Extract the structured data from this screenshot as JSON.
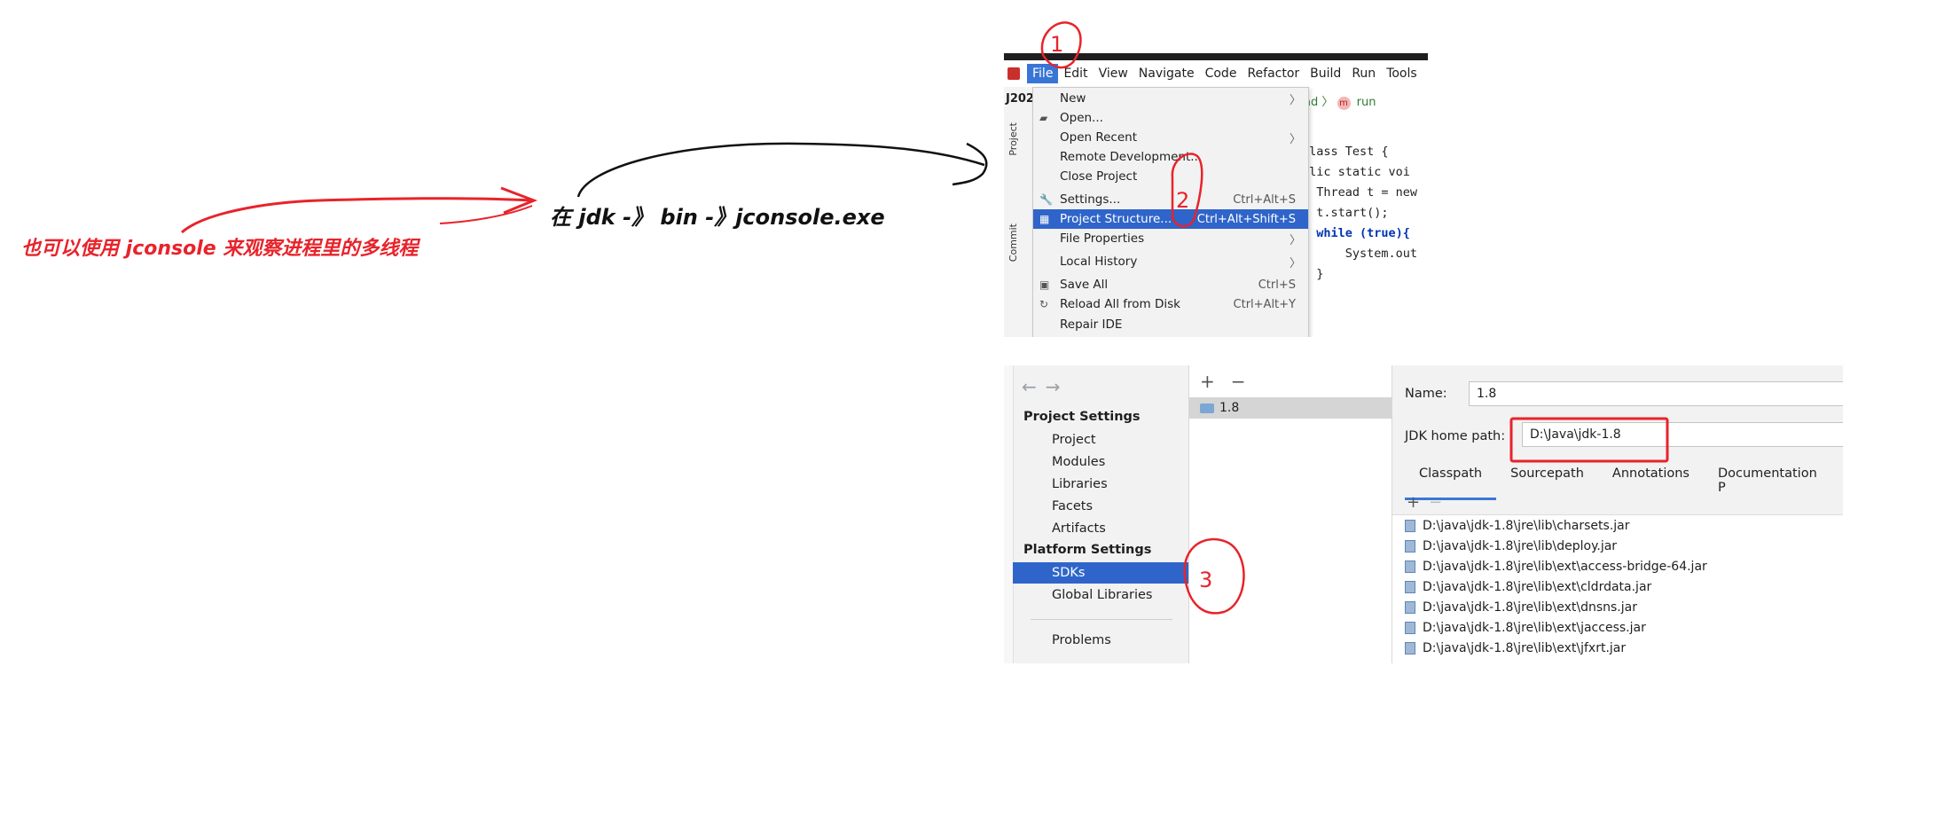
{
  "annotations": {
    "red_note": "也可以使用 jconsole 来观察进程里的多线程",
    "black_note": "在 jdk -》 bin -》jconsole.exe",
    "marker_1": "1",
    "marker_2": "2",
    "marker_3": "3"
  },
  "ide": {
    "project_label": "J202",
    "menubar": [
      "File",
      "Edit",
      "View",
      "Navigate",
      "Code",
      "Refactor",
      "Build",
      "Run",
      "Tools"
    ],
    "side_tabs": [
      "Project",
      "Commit"
    ],
    "breadcrumb": {
      "thread": "ead",
      "method_badge": "m",
      "method": "run"
    },
    "code_lines": [
      "class Test {",
      "blic static voi",
      "  Thread t = new",
      "  t.start();",
      "  while (true){",
      "      System.out",
      "  }"
    ],
    "file_menu": [
      {
        "label": "New",
        "shortcut": "",
        "submenu": true,
        "icon": ""
      },
      {
        "label": "Open...",
        "shortcut": "",
        "submenu": false,
        "icon": "folder-icon"
      },
      {
        "label": "Open Recent",
        "shortcut": "",
        "submenu": true,
        "icon": ""
      },
      {
        "label": "Remote Development...",
        "shortcut": "",
        "submenu": false,
        "icon": ""
      },
      {
        "label": "Close Project",
        "shortcut": "",
        "submenu": false,
        "icon": ""
      },
      {
        "label": "Settings...",
        "shortcut": "Ctrl+Alt+S",
        "submenu": false,
        "icon": "wrench-icon"
      },
      {
        "label": "Project Structure...",
        "shortcut": "Ctrl+Alt+Shift+S",
        "submenu": false,
        "icon": "project-structure-icon"
      },
      {
        "label": "File Properties",
        "shortcut": "",
        "submenu": true,
        "icon": ""
      },
      {
        "label": "Local History",
        "shortcut": "",
        "submenu": true,
        "icon": ""
      },
      {
        "label": "Save All",
        "shortcut": "Ctrl+S",
        "submenu": false,
        "icon": "save-icon"
      },
      {
        "label": "Reload All from Disk",
        "shortcut": "Ctrl+Alt+Y",
        "submenu": false,
        "icon": "reload-icon"
      },
      {
        "label": "Repair IDE",
        "shortcut": "",
        "submenu": false,
        "icon": ""
      }
    ]
  },
  "project_structure": {
    "project_settings_heading": "Project Settings",
    "project_settings_items": [
      "Project",
      "Modules",
      "Libraries",
      "Facets",
      "Artifacts"
    ],
    "platform_settings_heading": "Platform Settings",
    "platform_settings_items": [
      "SDKs",
      "Global Libraries"
    ],
    "problems": "Problems",
    "selected_item": "SDKs",
    "sdk_entry": "1.8",
    "name_label": "Name:",
    "name_value": "1.8",
    "jdk_home_label": "JDK home path:",
    "jdk_home_value": "D:\\Java\\jdk-1.8",
    "tabs": [
      "Classpath",
      "Sourcepath",
      "Annotations",
      "Documentation P"
    ],
    "active_tab": "Classpath",
    "classpath": [
      "D:\\java\\jdk-1.8\\jre\\lib\\charsets.jar",
      "D:\\java\\jdk-1.8\\jre\\lib\\deploy.jar",
      "D:\\java\\jdk-1.8\\jre\\lib\\ext\\access-bridge-64.jar",
      "D:\\java\\jdk-1.8\\jre\\lib\\ext\\cldrdata.jar",
      "D:\\java\\jdk-1.8\\jre\\lib\\ext\\dnsns.jar",
      "D:\\java\\jdk-1.8\\jre\\lib\\ext\\jaccess.jar",
      "D:\\java\\jdk-1.8\\jre\\lib\\ext\\jfxrt.jar"
    ]
  },
  "colors": {
    "annotation_red": "#e8232b",
    "selection_blue": "#2f65ca",
    "ink_black": "#111111"
  }
}
